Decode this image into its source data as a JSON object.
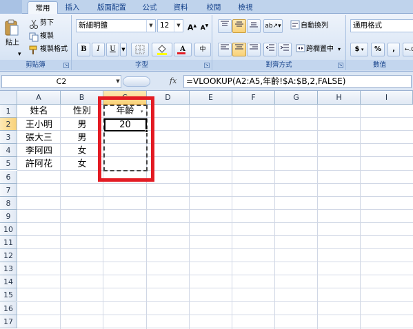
{
  "tabs": [
    "常用",
    "插入",
    "版面配置",
    "公式",
    "資料",
    "校閱",
    "檢視"
  ],
  "clipboard": {
    "paste": "貼上",
    "cut": "剪下",
    "copy": "複製",
    "format_painter": "複製格式",
    "group_label": "剪貼簿"
  },
  "font": {
    "name": "新細明體",
    "size": "12",
    "grow": "A",
    "shrink": "A",
    "bold": "B",
    "italic": "I",
    "underline": "U",
    "font_color_glyph": "A",
    "phonetic": "中",
    "group_label": "字型"
  },
  "alignment": {
    "wrap_text": "自動換列",
    "merge_center": "跨欄置中",
    "group_label": "對齊方式"
  },
  "number": {
    "format": "通用格式",
    "currency": "$",
    "percent": "%",
    "comma": ",",
    "group_label": "數值"
  },
  "formula_bar": {
    "name_box": "C2",
    "fx": "fx",
    "formula": "=VLOOKUP(A2:A5,年齡!$A:$B,2,FALSE)"
  },
  "sheet": {
    "columns": [
      "A",
      "B",
      "C",
      "D",
      "E",
      "F",
      "G",
      "H",
      "I"
    ],
    "selected_column": "C",
    "rows": [
      "1",
      "2",
      "3",
      "4",
      "5",
      "6",
      "7",
      "8",
      "9",
      "10",
      "11",
      "12",
      "13",
      "14",
      "15",
      "16",
      "17"
    ],
    "cells": {
      "A1": "姓名",
      "B1": "性別",
      "C1": "年齡",
      "A2": "王小明",
      "B2": "男",
      "C2": "20",
      "A3": "張大三",
      "B3": "男",
      "A4": "李阿四",
      "B4": "女",
      "A5": "許阿花",
      "B5": "女"
    },
    "highlight_color": "#e31b23"
  }
}
